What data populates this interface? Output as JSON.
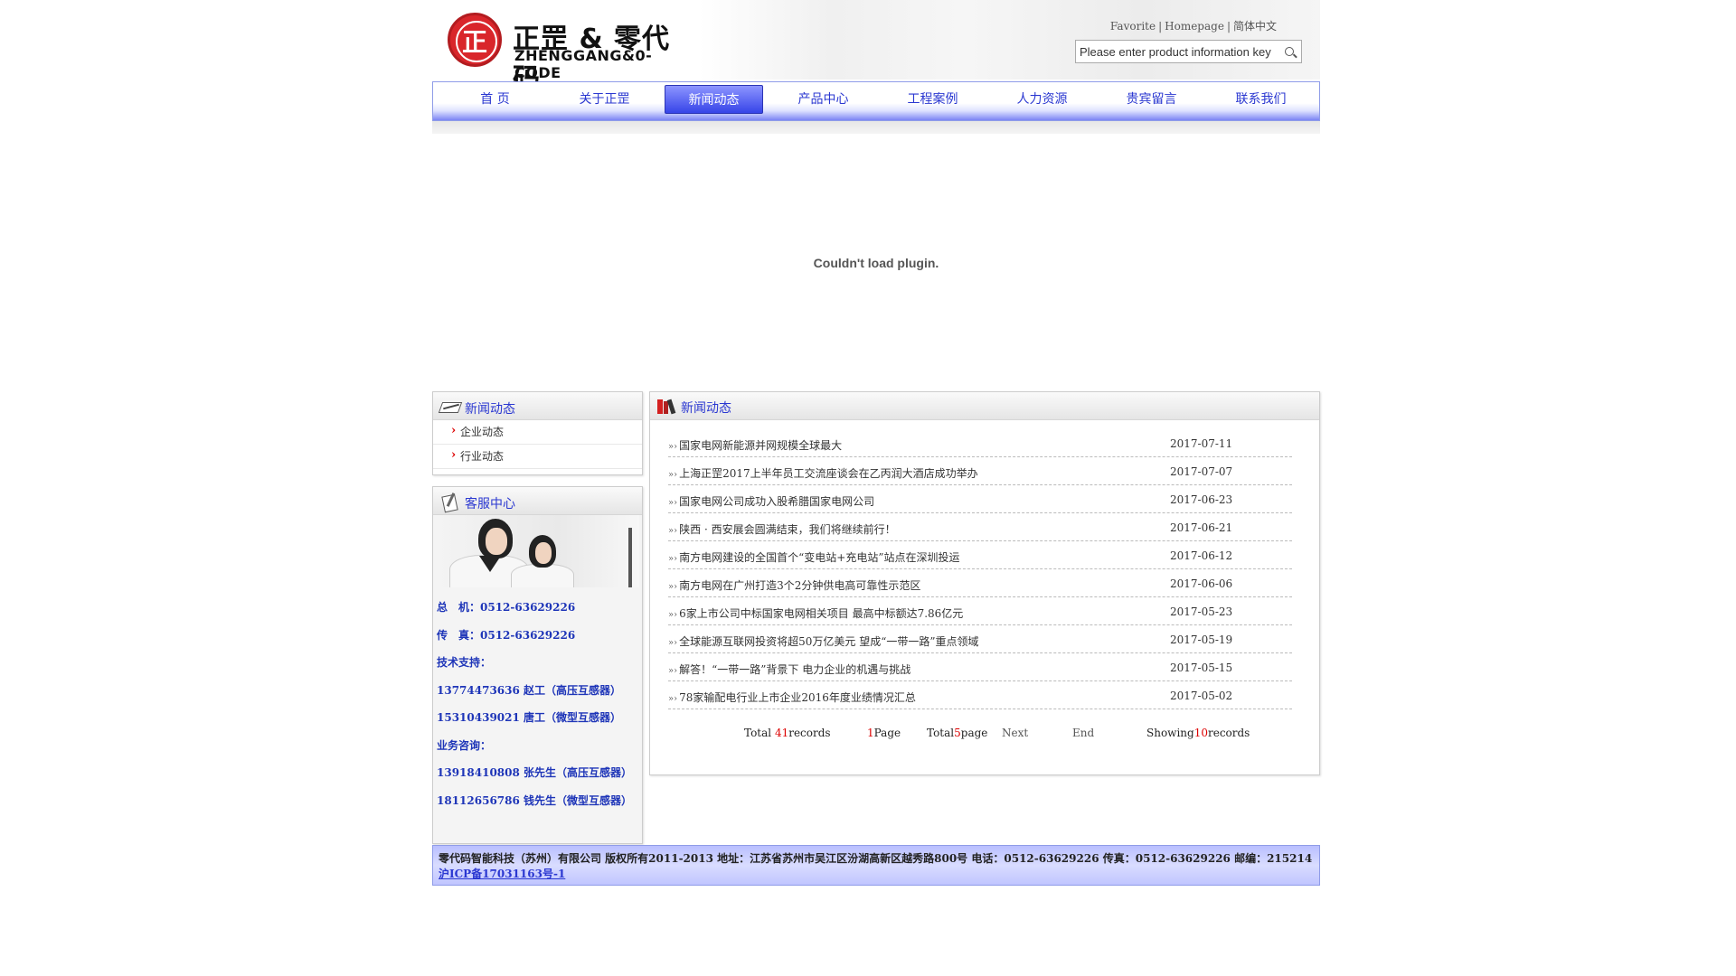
{
  "header": {
    "logo_cn": "正罡 & 零代码",
    "logo_en": "ZHENGGANG&0-CODE",
    "links": [
      "Favorite",
      "Homepage",
      "简体中文"
    ],
    "search_placeholder": "Please enter product information key"
  },
  "nav": {
    "items": [
      "首  页",
      "关于正罡",
      "新闻动态",
      "产品中心",
      "工程案例",
      "人力资源",
      "贵宾留言",
      "联系我们"
    ],
    "active": "新闻动态"
  },
  "plugin": {
    "message": "Couldn't load plugin."
  },
  "sidebar": {
    "news_title": "新闻动态",
    "categories": [
      "企业动态",
      "行业动态"
    ],
    "service_title": "客服中心",
    "service_lines": [
      "总　机：0512-63629226",
      "传　真：0512-63629226",
      "技术支持：",
      "13774473636 赵工（高压互感器）",
      "15310439021 唐工（微型互感器）",
      "业务咨询：",
      "13918410808 张先生（高压互感器）",
      "18112656786 钱先生（微型互感器）"
    ]
  },
  "main": {
    "title": "新闻动态",
    "news": [
      {
        "title": "国家电网新能源并网规模全球最大",
        "date": "2017-07-11"
      },
      {
        "title": "上海正罡2017上半年员工交流座谈会在乙丙润大酒店成功举办",
        "date": "2017-07-07"
      },
      {
        "title": "国家电网公司成功入股希腊国家电网公司",
        "date": "2017-06-23"
      },
      {
        "title": "陕西 · 西安展会圆满结束，我们将继续前行！",
        "date": "2017-06-21"
      },
      {
        "title": "南方电网建设的全国首个“变电站+充电站”站点在深圳投运",
        "date": "2017-06-12"
      },
      {
        "title": "南方电网在广州打造3个2分钟供电高可靠性示范区",
        "date": "2017-06-06"
      },
      {
        "title": "6家上市公司中标国家电网相关项目 最高中标额达7.86亿元",
        "date": "2017-05-23"
      },
      {
        "title": "全球能源互联网投资将超50万亿美元 望成“一带一路”重点领域",
        "date": "2017-05-19"
      },
      {
        "title": "解答！“一带一路”背景下 电力企业的机遇与挑战",
        "date": "2017-05-15"
      },
      {
        "title": "78家输配电行业上市企业2016年度业绩情况汇总",
        "date": "2017-05-02"
      }
    ],
    "pager": {
      "total_prefix": "Total ",
      "total_count": "41",
      "total_suffix": "records",
      "page_num": "1",
      "page_suffix": "Page",
      "total_pages_prefix": "Total",
      "total_pages": "5",
      "total_pages_suffix": "page",
      "next": "Next",
      "end": "End",
      "showing_prefix": "Showing",
      "showing_count": "10",
      "showing_suffix": "records"
    }
  },
  "footer": {
    "text": "零代码智能科技（苏州）有限公司 版权所有2011-2013 地址：江苏省苏州市吴江区汾湖高新区越秀路800号 电话：0512-63629226 传真：0512-63629226 邮编：215214 ",
    "icp": "沪ICP备17031163号-1"
  },
  "colors": {
    "nav_blue": "#2a37d1",
    "active_tab": "#3644e8",
    "accent_red": "#d00000"
  }
}
